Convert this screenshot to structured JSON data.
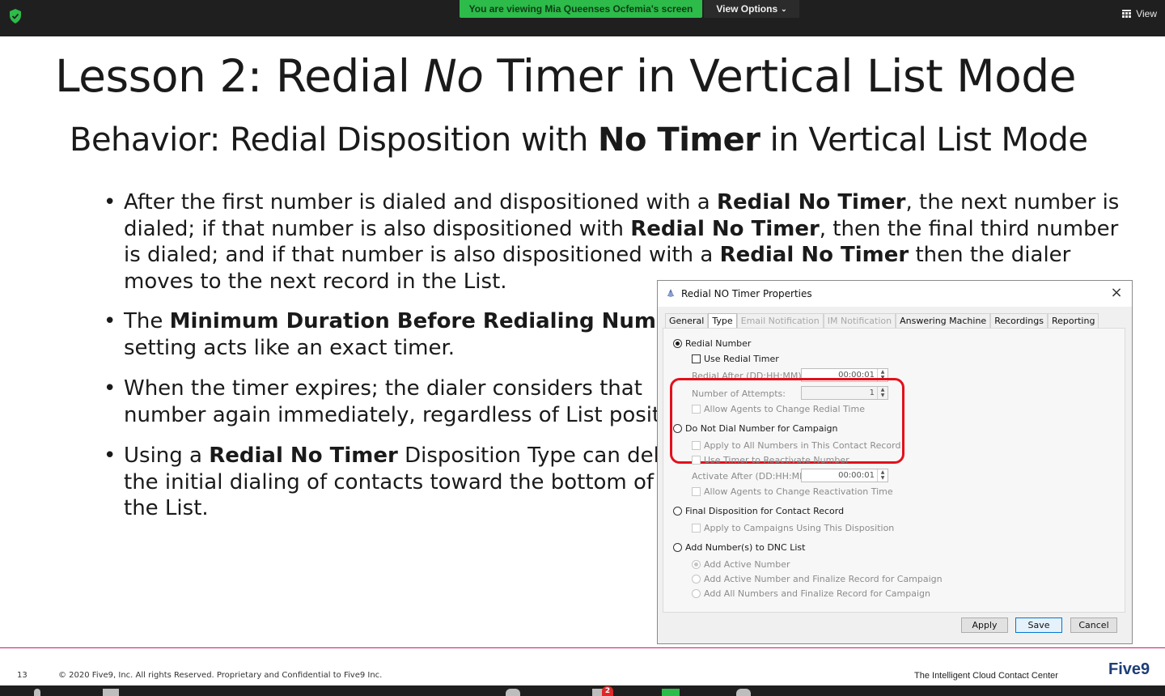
{
  "zoom": {
    "share_banner": "You are viewing Mia Queenses Ocfemia's screen",
    "view_options": "View Options",
    "view": "View",
    "participants_badge": "2"
  },
  "slide": {
    "title_part1": "Lesson 2: Redial ",
    "title_italic": "No",
    "title_part2": " Timer in Vertical List Mode",
    "subtitle_part1": "Behavior: Redial Disposition with ",
    "subtitle_bold": "No Timer",
    "subtitle_part2": " in Vertical List Mode",
    "bullets": [
      {
        "lines": [
          [
            "After the first number is dialed and dispositioned with a ",
            "Redial No Timer",
            ", the next number is"
          ],
          [
            "dialed; if that number is also dispositioned with ",
            "Redial No Timer",
            ", then the final third number"
          ],
          [
            "is dialed; and if that number is also dispositioned with a ",
            "Redial No Timer",
            " then the dialer"
          ],
          [
            "moves to the next record in the List.",
            "",
            ""
          ]
        ]
      },
      {
        "lines": [
          [
            "The ",
            "Minimum Duration Before Redialing Number",
            ""
          ],
          [
            "setting acts like an exact timer.",
            "",
            ""
          ]
        ]
      },
      {
        "lines": [
          [
            "When the timer expires; the dialer considers that",
            "",
            ""
          ],
          [
            "number again immediately, regardless of List position.",
            "",
            ""
          ]
        ]
      },
      {
        "lines": [
          [
            "Using a ",
            "Redial No Timer",
            " Disposition Type can delay"
          ],
          [
            "the initial dialing of contacts toward the bottom of",
            "",
            ""
          ],
          [
            "the List.",
            "",
            ""
          ]
        ]
      }
    ]
  },
  "dialog": {
    "title": "Redial NO Timer Properties",
    "tabs": [
      "General",
      "Type",
      "Email Notification",
      "IM Notification",
      "Answering Machine",
      "Recordings",
      "Reporting"
    ],
    "active_tab": "Type",
    "redial_number": "Redial Number",
    "use_redial_timer": "Use Redial Timer",
    "redial_after_label": "Redial After (DD:HH:MM):",
    "redial_after_value": "00:00:01",
    "attempts_label": "Number of Attempts:",
    "attempts_value": "1",
    "allow_change_redial": "Allow Agents to Change Redial Time",
    "do_not_dial": "Do Not Dial Number for Campaign",
    "apply_all_numbers": "Apply to All Numbers in This Contact Record",
    "use_timer_reactivate": "Use Timer to Reactivate Number",
    "activate_after_label": "Activate After (DD:HH:MM):",
    "activate_after_value": "00:00:01",
    "allow_change_reactivation": "Allow Agents to Change Reactivation Time",
    "final_disposition": "Final Disposition for Contact Record",
    "apply_campaigns": "Apply to Campaigns Using This Disposition",
    "add_dnc": "Add Number(s) to DNC List",
    "add_active": "Add Active Number",
    "add_active_finalize": "Add Active Number and Finalize Record for Campaign",
    "add_all_finalize": "Add All Numbers and Finalize Record for Campaign",
    "apply": "Apply",
    "save": "Save",
    "cancel": "Cancel"
  },
  "footer": {
    "page_number": "13",
    "copyright": "© 2020 Five9, Inc.  All rights Reserved. Proprietary and Confidential to Five9 Inc.",
    "tagline": "The Intelligent Cloud Contact Center",
    "logo": "Five9"
  },
  "colors": {
    "banner_green": "#2dbb4a",
    "highlight_red": "#e3101c",
    "footer_magenta": "#c61a7a",
    "logo_blue": "#1e3d78"
  }
}
